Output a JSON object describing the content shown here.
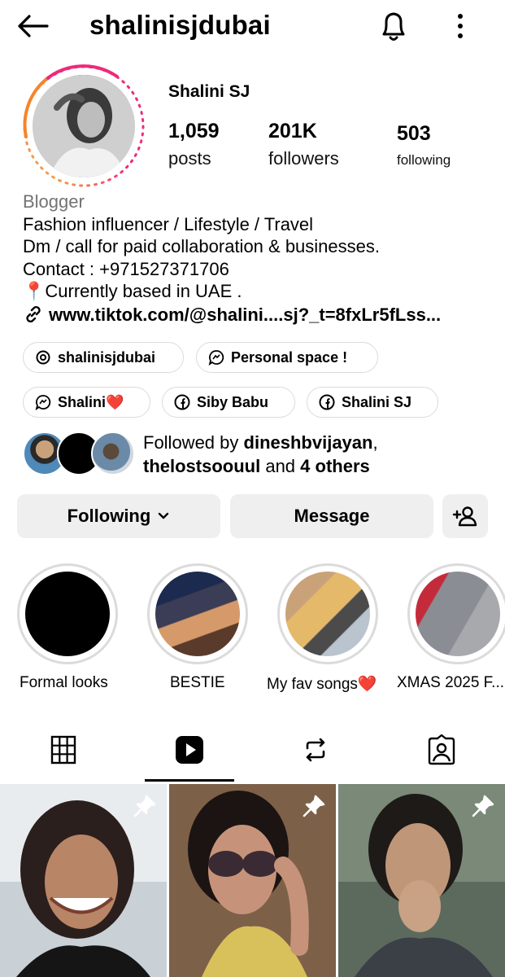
{
  "header": {
    "username": "shalinisjdubai",
    "back_icon": "arrow-left-icon",
    "bell_icon": "bell-icon",
    "more_icon": "more-vertical-icon"
  },
  "profile": {
    "full_name": "Shalini SJ",
    "stats": {
      "posts_value": "1,059",
      "posts_label": "posts",
      "followers_value": "201K",
      "followers_label": "followers",
      "following_value": "503",
      "following_label": "following"
    },
    "category": "Blogger",
    "bio_lines": [
      "Fashion influencer / Lifestyle / Travel",
      "Dm / call for paid collaboration & businesses.",
      "Contact : +971527371706",
      "📍Currently based in UAE ."
    ],
    "link": "www.tiktok.com/@shalini....sj?_t=8fxLr5fLss..."
  },
  "chips": [
    {
      "label": "shalinisjdubai",
      "icon": "threads-icon"
    },
    {
      "label": "Personal space !",
      "icon": "messenger-chat-icon"
    },
    {
      "label": "Shalini❤️",
      "icon": "messenger-chat-icon"
    },
    {
      "label": "Siby Babu",
      "icon": "facebook-icon"
    },
    {
      "label": "Shalini SJ",
      "icon": "facebook-icon"
    }
  ],
  "followed_by": {
    "prefix": "Followed by ",
    "user1": "dineshbvijayan",
    "comma": ",",
    "user2": "thelostsoouul",
    "and": " and ",
    "others": "4 others"
  },
  "actions": {
    "following_label": "Following",
    "message_label": "Message",
    "add_user_icon": "add-user-icon"
  },
  "highlights": [
    {
      "label": "Formal looks"
    },
    {
      "label": "BESTIE"
    },
    {
      "label": "My fav songs❤️"
    },
    {
      "label": "XMAS 2025 F..."
    }
  ],
  "tabs": [
    {
      "icon": "grid-icon",
      "selected": false
    },
    {
      "icon": "reels-icon",
      "selected": true
    },
    {
      "icon": "repost-icon",
      "selected": false
    },
    {
      "icon": "tagged-icon",
      "selected": false
    }
  ],
  "colors": {
    "story_ring_a": "#f9ce34",
    "story_ring_b": "#ee2a7b",
    "chip_border": "#dbdbdb",
    "button_bg": "#efefef",
    "muted_text": "#737373"
  }
}
